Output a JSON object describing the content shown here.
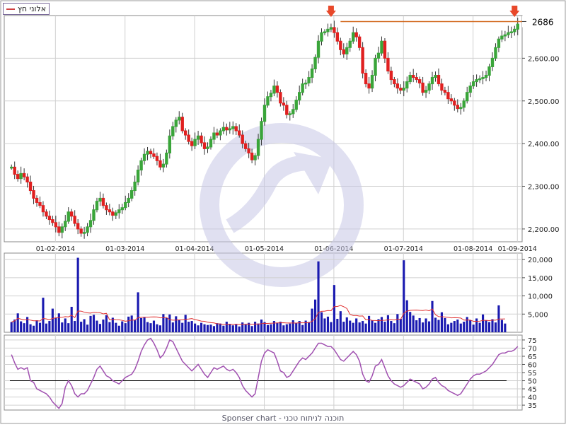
{
  "legend": {
    "label": "אלוני חץ",
    "color": "#d04040"
  },
  "footer": {
    "text": "Sponser chart - תוכנה לניתוח טכני"
  },
  "colors": {
    "up": "#3aa53a",
    "down": "#e02020",
    "grid": "#d0d0d0",
    "resistance": "#d2691e",
    "marker": "#e8482a",
    "volume": "#1a1ab0",
    "volume_ma": "#e03030",
    "rsi": "#a050b0",
    "rsi_mid": "#000000",
    "watermark": "#c8c8e6"
  },
  "chart_data": [
    {
      "type": "candlestick",
      "title": "",
      "x_ticks": [
        "01-02-2014",
        "01-03-2014",
        "01-04-2014",
        "01-05-2014",
        "01-06-2014",
        "01-07-2014",
        "01-08-2014",
        "01-09-2014"
      ],
      "y_ticks": [
        "2,200.00",
        "2,300.00",
        "2,400.00",
        "2,500.00",
        "2,600.00"
      ],
      "ylim": [
        2170,
        2700
      ],
      "grid": true,
      "last_price_label": "2686",
      "resistance_level": 2686,
      "markers": [
        "peak-arrow",
        "peak-arrow"
      ],
      "close": [
        2345,
        2328,
        2318,
        2330,
        2322,
        2310,
        2290,
        2272,
        2262,
        2255,
        2240,
        2230,
        2222,
        2215,
        2205,
        2192,
        2205,
        2218,
        2240,
        2230,
        2213,
        2200,
        2190,
        2192,
        2205,
        2220,
        2245,
        2265,
        2272,
        2255,
        2245,
        2240,
        2232,
        2238,
        2245,
        2250,
        2262,
        2272,
        2290,
        2310,
        2338,
        2360,
        2375,
        2382,
        2376,
        2370,
        2360,
        2345,
        2352,
        2378,
        2418,
        2440,
        2455,
        2462,
        2430,
        2420,
        2405,
        2395,
        2410,
        2418,
        2402,
        2388,
        2392,
        2410,
        2425,
        2420,
        2430,
        2438,
        2432,
        2435,
        2440,
        2430,
        2420,
        2400,
        2388,
        2378,
        2362,
        2372,
        2410,
        2452,
        2490,
        2510,
        2518,
        2535,
        2520,
        2495,
        2490,
        2468,
        2470,
        2480,
        2502,
        2520,
        2540,
        2542,
        2555,
        2575,
        2602,
        2640,
        2660,
        2662,
        2668,
        2672,
        2660,
        2640,
        2620,
        2610,
        2625,
        2640,
        2660,
        2650,
        2625,
        2565,
        2540,
        2530,
        2560,
        2600,
        2612,
        2640,
        2600,
        2570,
        2550,
        2540,
        2530,
        2525,
        2530,
        2545,
        2560,
        2555,
        2550,
        2542,
        2520,
        2525,
        2540,
        2555,
        2560,
        2540,
        2525,
        2520,
        2505,
        2500,
        2490,
        2482,
        2485,
        2500,
        2520,
        2535,
        2545,
        2550,
        2552,
        2555,
        2560,
        2580,
        2600,
        2625,
        2645,
        2652,
        2655,
        2660,
        2662,
        2668,
        2680
      ]
    },
    {
      "type": "bar",
      "y_ticks": [
        "5,000",
        "10,000",
        "15,000",
        "20,000"
      ],
      "ylim": [
        0,
        21000
      ],
      "volume": [
        2800,
        3500,
        5200,
        3000,
        2500,
        4200,
        2200,
        1800,
        3300,
        2600,
        9500,
        2400,
        3100,
        6500,
        4000,
        5200,
        2700,
        3800,
        2500,
        7000,
        3100,
        20500,
        2900,
        3600,
        2100,
        4500,
        4800,
        3200,
        2300,
        3500,
        4700,
        2800,
        4000,
        2600,
        1800,
        3000,
        2500,
        4300,
        4600,
        3300,
        11000,
        3900,
        4200,
        2800,
        2500,
        3200,
        2200,
        1900,
        5000,
        3900,
        4900,
        2700,
        4400,
        3300,
        2600,
        4800,
        2900,
        3100,
        2400,
        1900,
        2600,
        2200,
        2000,
        2100,
        1700,
        2500,
        2400,
        1800,
        2900,
        2200,
        1900,
        2300,
        1600,
        2700,
        2100,
        2600,
        1700,
        2900,
        2400,
        3500,
        2800,
        2000,
        2200,
        3100,
        2600,
        2900,
        1900,
        2200,
        2400,
        3300,
        2600,
        3100,
        2000,
        3200,
        2800,
        6500,
        9000,
        19500,
        5500,
        3800,
        4300,
        2800,
        13000,
        3700,
        5800,
        2900,
        4100,
        3200,
        2600,
        3800,
        2700,
        3100,
        2400,
        4500,
        3300,
        2600,
        3600,
        4200,
        2900,
        4700,
        3100,
        2500,
        5000,
        3700,
        19800,
        8800,
        5600,
        4600,
        3300,
        3900,
        2700,
        3800,
        3000,
        8600,
        4000,
        3400,
        5500,
        3900,
        2200,
        2600,
        3100,
        3500,
        2400,
        2900,
        4200,
        3300,
        2100,
        3800,
        2600,
        4900,
        3200,
        2800,
        3600,
        2700,
        7400,
        3400,
        2400
      ]
    },
    {
      "type": "line",
      "y_ticks": [
        "35",
        "40",
        "45",
        "50",
        "55",
        "60",
        "65",
        "70",
        "75"
      ],
      "ylim": [
        32,
        78
      ],
      "reference_line": 50,
      "rsi": [
        66,
        61,
        57,
        58,
        57,
        58,
        50,
        49,
        45,
        44,
        43,
        42,
        40,
        37,
        35,
        33,
        36,
        46,
        50,
        47,
        42,
        40,
        42,
        42,
        44,
        48,
        52,
        57,
        59,
        56,
        53,
        52,
        50,
        49,
        48,
        50,
        52,
        53,
        54,
        57,
        62,
        68,
        72,
        75,
        76,
        73,
        69,
        64,
        66,
        70,
        75,
        74,
        70,
        66,
        62,
        60,
        58,
        56,
        58,
        60,
        57,
        54,
        52,
        55,
        58,
        57,
        58,
        59,
        57,
        56,
        57,
        55,
        52,
        47,
        44,
        42,
        40,
        42,
        52,
        62,
        67,
        69,
        68,
        67,
        62,
        56,
        55,
        52,
        53,
        56,
        59,
        62,
        64,
        63,
        65,
        67,
        70,
        73,
        73,
        72,
        71,
        71,
        69,
        66,
        63,
        62,
        64,
        66,
        68,
        66,
        62,
        54,
        50,
        49,
        53,
        59,
        60,
        63,
        58,
        53,
        50,
        48,
        47,
        46,
        47,
        49,
        51,
        50,
        49,
        48,
        45,
        46,
        48,
        51,
        52,
        49,
        47,
        46,
        44,
        43,
        42,
        41,
        42,
        45,
        48,
        51,
        53,
        54,
        54,
        55,
        56,
        58,
        60,
        63,
        66,
        67,
        67,
        68,
        68,
        69,
        71
      ]
    }
  ]
}
